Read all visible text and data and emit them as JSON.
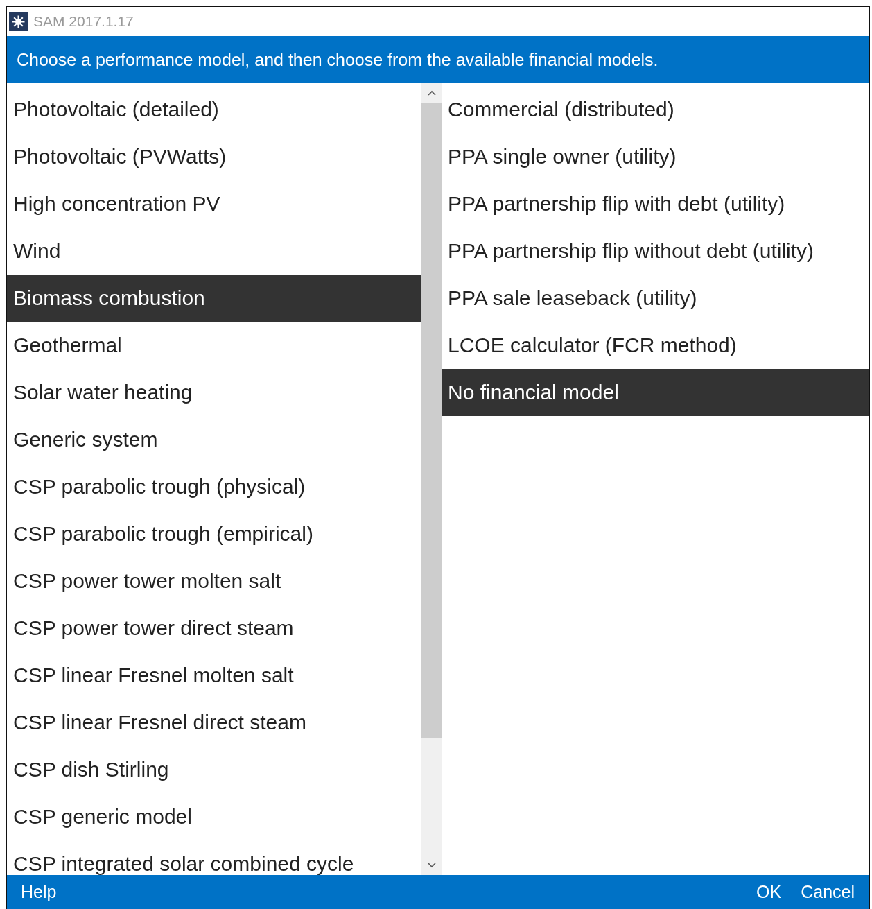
{
  "window": {
    "title": "SAM 2017.1.17"
  },
  "header": {
    "text": "Choose a performance model, and then choose from the available financial models."
  },
  "performance_models": [
    {
      "label": "Photovoltaic (detailed)",
      "selected": false
    },
    {
      "label": "Photovoltaic (PVWatts)",
      "selected": false
    },
    {
      "label": "High concentration PV",
      "selected": false
    },
    {
      "label": "Wind",
      "selected": false
    },
    {
      "label": "Biomass combustion",
      "selected": true
    },
    {
      "label": "Geothermal",
      "selected": false
    },
    {
      "label": "Solar water heating",
      "selected": false
    },
    {
      "label": "Generic system",
      "selected": false
    },
    {
      "label": "CSP parabolic trough (physical)",
      "selected": false
    },
    {
      "label": "CSP parabolic trough (empirical)",
      "selected": false
    },
    {
      "label": "CSP power tower molten salt",
      "selected": false
    },
    {
      "label": "CSP power tower direct steam",
      "selected": false
    },
    {
      "label": "CSP linear Fresnel molten salt",
      "selected": false
    },
    {
      "label": "CSP linear Fresnel direct steam",
      "selected": false
    },
    {
      "label": "CSP dish Stirling",
      "selected": false
    },
    {
      "label": "CSP generic model",
      "selected": false
    },
    {
      "label": "CSP integrated solar combined cycle",
      "selected": false
    }
  ],
  "financial_models": [
    {
      "label": "Commercial (distributed)",
      "selected": false
    },
    {
      "label": "PPA single owner (utility)",
      "selected": false
    },
    {
      "label": "PPA partnership flip with debt (utility)",
      "selected": false
    },
    {
      "label": "PPA partnership flip without debt (utility)",
      "selected": false
    },
    {
      "label": "PPA sale leaseback (utility)",
      "selected": false
    },
    {
      "label": "LCOE calculator (FCR method)",
      "selected": false
    },
    {
      "label": "No financial model",
      "selected": true
    }
  ],
  "footer": {
    "help": "Help",
    "ok": "OK",
    "cancel": "Cancel"
  }
}
